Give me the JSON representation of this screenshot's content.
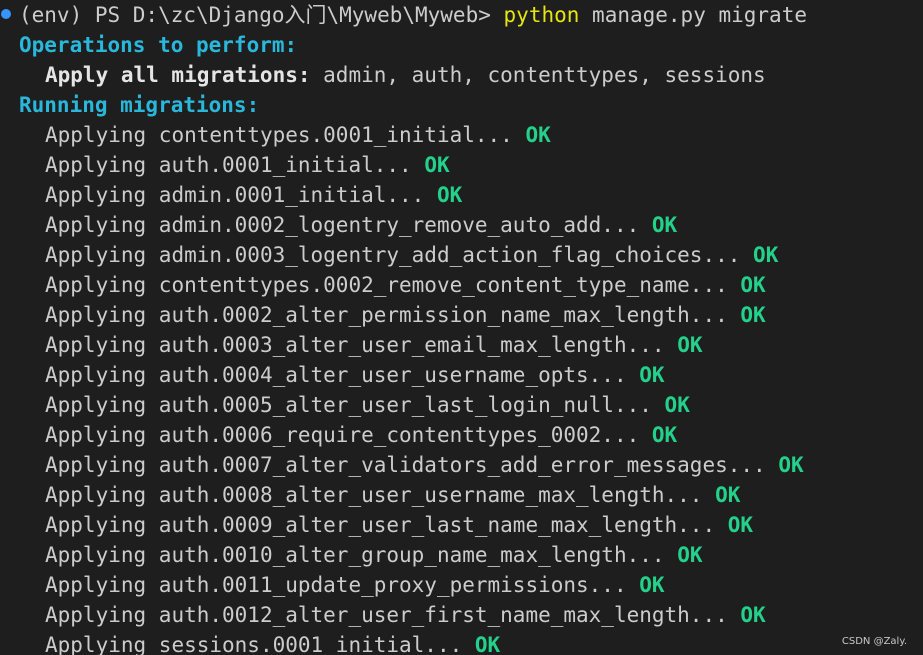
{
  "prompt": {
    "path": "(env) PS D:\\zc\\Django入门\\Myweb\\Myweb>",
    "command": "python",
    "args": "manage.py migrate"
  },
  "ops_heading": "Operations to perform:",
  "apply_label": "Apply all migrations:",
  "apply_apps": " admin, auth, contenttypes, sessions",
  "running_heading": "Running migrations:",
  "applying_word": "Applying ",
  "ok_text": "OK",
  "migrations": [
    "contenttypes.0001_initial...",
    "auth.0001_initial...",
    "admin.0001_initial...",
    "admin.0002_logentry_remove_auto_add...",
    "admin.0003_logentry_add_action_flag_choices...",
    "contenttypes.0002_remove_content_type_name...",
    "auth.0002_alter_permission_name_max_length...",
    "auth.0003_alter_user_email_max_length...",
    "auth.0004_alter_user_username_opts...",
    "auth.0005_alter_user_last_login_null...",
    "auth.0006_require_contenttypes_0002...",
    "auth.0007_alter_validators_add_error_messages...",
    "auth.0008_alter_user_username_max_length...",
    "auth.0009_alter_user_last_name_max_length...",
    "auth.0010_alter_group_name_max_length...",
    "auth.0011_update_proxy_permissions...",
    "auth.0012_alter_user_first_name_max_length...",
    "sessions.0001_initial..."
  ],
  "watermark": "CSDN @Zaly."
}
